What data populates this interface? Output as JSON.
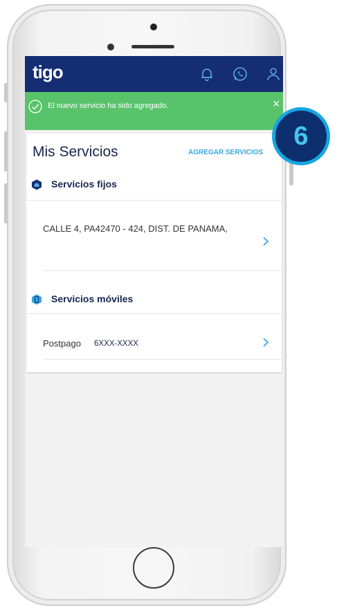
{
  "app": {
    "logo_text": "tigo",
    "header_icons": [
      "bell-icon",
      "whatsapp-icon",
      "user-icon"
    ]
  },
  "toast": {
    "message": "El nuevo servicio ha sido agregado.",
    "close_symbol": "×",
    "icon": "check-circle-icon"
  },
  "main": {
    "title": "Mis Servicios",
    "add_link": "AGREGAR SERVICIOS",
    "sections": [
      {
        "label": "Servicios fijos",
        "icon": "home-icon",
        "items": [
          {
            "text": "CALLE 4, PA42470 - 424, DIST. DE PANAMA,"
          }
        ]
      },
      {
        "label": "Servicios móviles",
        "icon": "mobile-icon",
        "items": [
          {
            "label": "Postpago",
            "number": "6XXX-XXXX"
          }
        ]
      }
    ]
  },
  "step_badge": "6",
  "colors": {
    "brand_navy": "#152d73",
    "success_green": "#58c36a",
    "link_blue": "#36a8e0",
    "badge_bg": "#0d2f6e",
    "badge_ring": "#16a6e0"
  }
}
